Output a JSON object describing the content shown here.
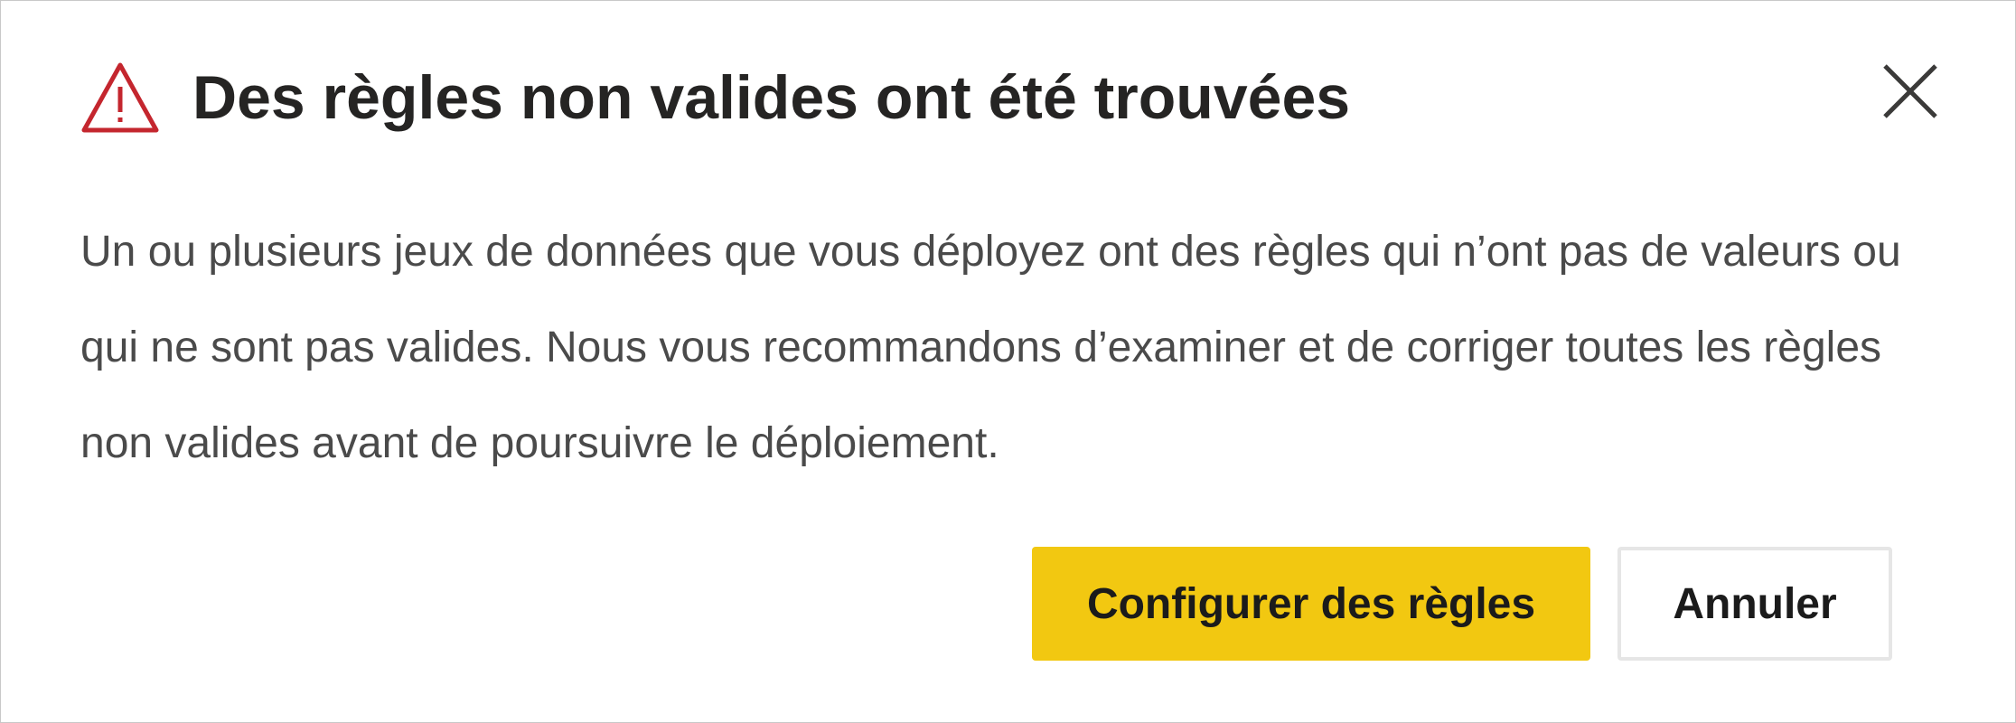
{
  "dialog": {
    "title": "Des règles non valides ont été trouvées",
    "title_icon": "warning-triangle-icon",
    "close_icon": "close-icon",
    "message": "Un ou plusieurs jeux de données que vous déployez ont des règles qui n’ont pas de valeurs ou qui ne sont pas valides. Nous vous recommandons d’examiner et de corriger toutes les règles non valides avant de poursuivre le déploiement.",
    "buttons": {
      "primary_label": "Configurer des règles",
      "secondary_label": "Annuler"
    }
  },
  "colors": {
    "warning_icon": "#c4262e",
    "primary_button": "#f2c811",
    "title_text": "#252423",
    "body_text": "#4a4a4a"
  }
}
